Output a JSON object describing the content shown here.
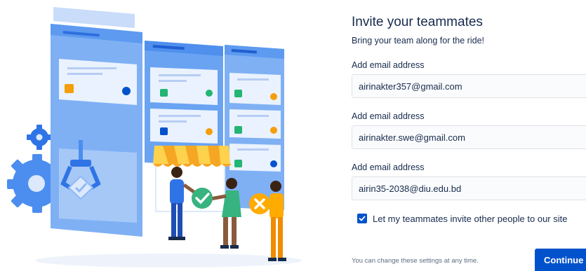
{
  "invite": {
    "title": "Invite your teammates",
    "subtitle": "Bring your team along for the ride!",
    "fields": [
      {
        "label": "Add email address",
        "value": "airinakter357@gmail.com"
      },
      {
        "label": "Add email address",
        "value": "airinakter.swe@gmail.com"
      },
      {
        "label": "Add email address",
        "value": "airin35-2038@diu.edu.bd"
      }
    ],
    "allow_invites": {
      "label": "Let my teammates invite other people to our site",
      "checked": true
    },
    "footnote": "You can change these settings at any time.",
    "continue_label": "Continue"
  },
  "colors": {
    "primary": "#0052cc",
    "text": "#172b4d",
    "muted": "#5e6c84",
    "field_border": "#dfe1e6",
    "field_bg": "#fafbfc"
  },
  "illustration": {
    "icons": [
      "kanban-board-icon",
      "gear-icon",
      "robot-claw-icon",
      "awning-icon",
      "check-badge-icon",
      "close-badge-icon",
      "team-people-icon"
    ]
  }
}
